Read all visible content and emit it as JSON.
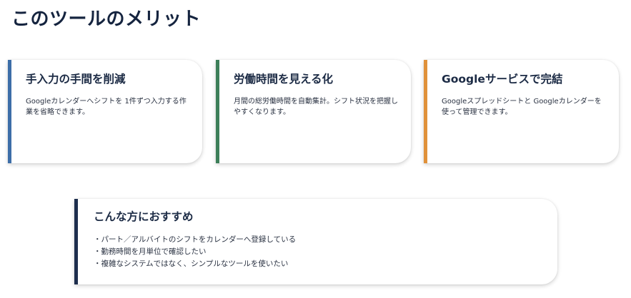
{
  "page": {
    "title": "このツールのメリット"
  },
  "benefits": [
    {
      "title": "手入力の手間を削減",
      "description": "Googleカレンダーへシフトを 1件ずつ入力する作業を省略できます。",
      "accent": "#3d6ea8"
    },
    {
      "title": "労働時間を見える化",
      "description": "月間の総労働時間を自動集計。シフト状況を把握しやすくなります。",
      "accent": "#3d7f59"
    },
    {
      "title": "Googleサービスで完結",
      "description": "Googleスプレッドシートと Googleカレンダーを使って管理できます。",
      "accent": "#e0913a"
    }
  ],
  "recommend": {
    "title": "こんな方におすすめ",
    "accent": "#1d2e4d",
    "items": [
      "・パート／アルバイトのシフトをカレンダーへ登録している",
      "・勤務時間を月単位で確認したい",
      "・複雑なシステムではなく、シンプルなツールを使いたい"
    ]
  }
}
